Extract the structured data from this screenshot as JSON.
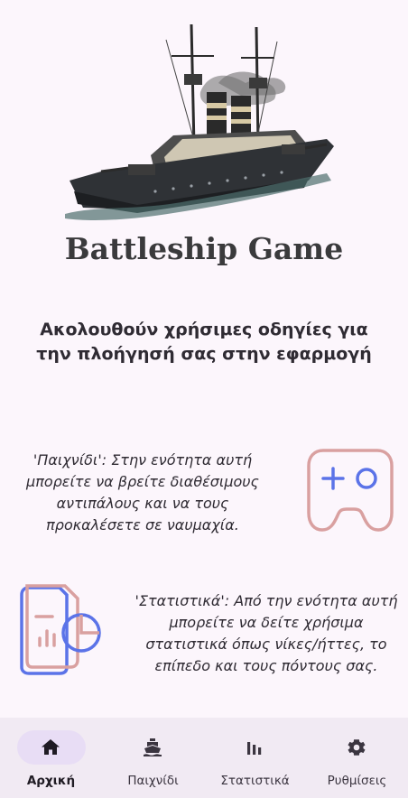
{
  "app": {
    "title": "Battleship Game",
    "subtitle": "Ακολουθούν χρήσιμες οδηγίες για την πλοήγησή σας στην εφαρμογή"
  },
  "sections": [
    {
      "text": "'Παιχνίδι': Στην ενότητα αυτή μπορείτε να βρείτε διαθέσιμους αντιπάλους και να τους προκαλέσετε σε ναυμαχία.",
      "icon": "gamepad-icon"
    },
    {
      "text": "'Στατιστικά': Από την ενότητα αυτή μπορείτε να δείτε χρήσιμα στατιστικά όπως νίκες/ήττες, το επίπεδο και τους πόντους σας.",
      "icon": "statistics-document-icon"
    }
  ],
  "nav": {
    "items": [
      {
        "label": "Αρχική",
        "icon": "home-icon",
        "active": true
      },
      {
        "label": "Παιχνίδι",
        "icon": "ship-icon",
        "active": false
      },
      {
        "label": "Στατιστικά",
        "icon": "bar-chart-icon",
        "active": false
      },
      {
        "label": "Ρυθμίσεις",
        "icon": "gear-icon",
        "active": false
      }
    ]
  },
  "colors": {
    "background": "#fcf6fc",
    "nav_background": "#f1eaf3",
    "active_pill": "#e8ddf5",
    "icon_pink": "#d9a0a0",
    "icon_blue": "#5b73e8"
  }
}
